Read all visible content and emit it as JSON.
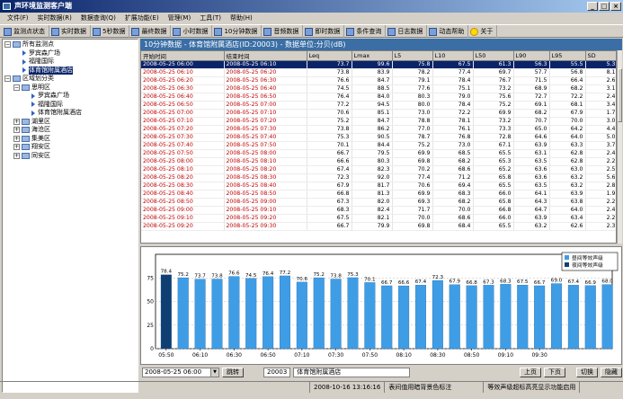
{
  "window": {
    "title": "声环境监测客户端",
    "controls": [
      "_",
      "□",
      "×"
    ]
  },
  "menu": [
    "文件(F)",
    "实时数据(R)",
    "数据查询(Q)",
    "扩展功能(E)",
    "管理(M)",
    "工具(T)",
    "帮助(H)"
  ],
  "toolbar": [
    {
      "label": "监测点状态",
      "icon": "monitor-icon"
    },
    {
      "label": "实时数据",
      "icon": "realtime-icon"
    },
    {
      "label": "5秒数据",
      "icon": "data-icon"
    },
    {
      "label": "最终数据",
      "icon": "data-icon"
    },
    {
      "label": "小时数据",
      "icon": "data-icon"
    },
    {
      "label": "10分钟数据",
      "icon": "data-icon"
    },
    {
      "label": "音频数据",
      "icon": "audio-icon"
    },
    {
      "label": "即时数据",
      "icon": "data-icon"
    },
    {
      "label": "条件查询",
      "icon": "query-icon"
    },
    {
      "label": "日志数据",
      "icon": "log-icon"
    },
    {
      "label": "动态帮助",
      "icon": "help-icon"
    },
    {
      "label": "关于",
      "icon": "bulb-icon"
    }
  ],
  "tree": [
    {
      "label": "所有监测点",
      "type": "root"
    },
    {
      "label": "罗宾森广场",
      "type": "leaf"
    },
    {
      "label": "福隆国际",
      "type": "leaf"
    },
    {
      "label": "体育馆附属酒店",
      "type": "leaf"
    },
    {
      "label": "区域划分类",
      "type": "root"
    },
    {
      "label": "思明区",
      "type": "folder"
    },
    {
      "label": "罗宾森广场",
      "type": "leaf"
    },
    {
      "label": "福隆国际",
      "type": "leaf"
    },
    {
      "label": "体育馆附属酒店",
      "type": "leaf"
    },
    {
      "label": "湖里区",
      "type": "folder"
    },
    {
      "label": "海沧区",
      "type": "folder"
    },
    {
      "label": "集美区",
      "type": "folder"
    },
    {
      "label": "翔安区",
      "type": "folder"
    },
    {
      "label": "同安区",
      "type": "folder"
    }
  ],
  "panel": {
    "header": "10分钟数据 - 体育馆附属酒店(ID:20003) - 数据单位:分贝(dB)"
  },
  "table": {
    "columns": [
      "开始时间",
      "结束时间",
      "Leq",
      "Lmax",
      "L5",
      "L10",
      "L50",
      "L90",
      "L95",
      "SD"
    ],
    "rows": [
      [
        "2008-05-25 06:00",
        "2008-05-25 06:10",
        "73.7",
        "99.6",
        "75.8",
        "67.5",
        "61.3",
        "56.3",
        "55.5",
        "5.3"
      ],
      [
        "2008-05-25 06:10",
        "2008-05-25 06:20",
        "73.8",
        "83.9",
        "78.2",
        "77.4",
        "69.7",
        "57.7",
        "56.8",
        "8.1"
      ],
      [
        "2008-05-25 06:20",
        "2008-05-25 06:30",
        "76.6",
        "84.7",
        "79.1",
        "78.4",
        "76.7",
        "71.5",
        "66.4",
        "2.6"
      ],
      [
        "2008-05-25 06:30",
        "2008-05-25 06:40",
        "74.5",
        "88.5",
        "77.6",
        "75.1",
        "73.2",
        "68.9",
        "68.2",
        "3.1"
      ],
      [
        "2008-05-25 06:40",
        "2008-05-25 06:50",
        "76.4",
        "84.0",
        "80.3",
        "79.0",
        "75.6",
        "72.7",
        "72.2",
        "2.4"
      ],
      [
        "2008-05-25 06:50",
        "2008-05-25 07:00",
        "77.2",
        "94.5",
        "80.0",
        "78.4",
        "75.2",
        "69.1",
        "68.1",
        "3.4"
      ],
      [
        "2008-05-25 07:00",
        "2008-05-25 07:10",
        "70.6",
        "85.1",
        "73.0",
        "72.2",
        "69.9",
        "68.2",
        "67.9",
        "1.7"
      ],
      [
        "2008-05-25 07:10",
        "2008-05-25 07:20",
        "75.2",
        "84.7",
        "78.8",
        "78.1",
        "73.2",
        "70.7",
        "70.0",
        "3.0"
      ],
      [
        "2008-05-25 07:20",
        "2008-05-25 07:30",
        "73.8",
        "86.2",
        "77.0",
        "76.1",
        "73.3",
        "65.0",
        "64.2",
        "4.4"
      ],
      [
        "2008-05-25 07:30",
        "2008-05-25 07:40",
        "75.3",
        "90.5",
        "78.7",
        "76.8",
        "72.8",
        "64.6",
        "64.0",
        "5.0"
      ],
      [
        "2008-05-25 07:40",
        "2008-05-25 07:50",
        "70.1",
        "84.4",
        "75.2",
        "73.0",
        "67.1",
        "63.9",
        "63.3",
        "3.7"
      ],
      [
        "2008-05-25 07:50",
        "2008-05-25 08:00",
        "66.7",
        "79.5",
        "69.9",
        "68.5",
        "65.5",
        "63.1",
        "62.8",
        "2.4"
      ],
      [
        "2008-05-25 08:00",
        "2008-05-25 08:10",
        "66.6",
        "80.3",
        "69.8",
        "68.2",
        "65.3",
        "63.5",
        "62.8",
        "2.2"
      ],
      [
        "2008-05-25 08:10",
        "2008-05-25 08:20",
        "67.4",
        "82.3",
        "70.2",
        "68.6",
        "65.2",
        "63.6",
        "63.0",
        "2.5"
      ],
      [
        "2008-05-25 08:20",
        "2008-05-25 08:30",
        "72.3",
        "92.0",
        "77.4",
        "71.2",
        "65.8",
        "63.6",
        "63.2",
        "5.6"
      ],
      [
        "2008-05-25 08:30",
        "2008-05-25 08:40",
        "67.9",
        "81.7",
        "70.6",
        "69.4",
        "65.5",
        "63.5",
        "63.2",
        "2.8"
      ],
      [
        "2008-05-25 08:40",
        "2008-05-25 08:50",
        "66.8",
        "81.3",
        "69.9",
        "68.3",
        "66.0",
        "64.1",
        "63.9",
        "1.9"
      ],
      [
        "2008-05-25 08:50",
        "2008-05-25 09:00",
        "67.3",
        "82.0",
        "69.3",
        "68.2",
        "65.8",
        "64.3",
        "63.8",
        "2.2"
      ],
      [
        "2008-05-25 09:00",
        "2008-05-25 09:10",
        "68.3",
        "82.4",
        "71.7",
        "70.0",
        "66.8",
        "64.7",
        "64.0",
        "2.4"
      ],
      [
        "2008-05-25 09:10",
        "2008-05-25 09:20",
        "67.5",
        "82.1",
        "70.0",
        "68.6",
        "66.0",
        "63.9",
        "63.4",
        "2.2"
      ],
      [
        "2008-05-25 09:20",
        "2008-05-25 09:30",
        "66.7",
        "79.9",
        "69.8",
        "68.4",
        "65.5",
        "63.2",
        "62.6",
        "2.3"
      ]
    ],
    "selected_row": 0
  },
  "chart_data": {
    "type": "bar",
    "categories": [
      "05:50",
      "06:00",
      "06:10",
      "06:20",
      "06:30",
      "06:40",
      "06:50",
      "07:00",
      "07:10",
      "07:20",
      "07:30",
      "07:40",
      "07:50",
      "08:00",
      "08:10",
      "08:20",
      "08:30",
      "08:40",
      "08:50",
      "09:00",
      "09:10",
      "09:20",
      "09:30",
      "09:40"
    ],
    "values": [
      78.4,
      75.2,
      73.7,
      73.8,
      76.6,
      74.5,
      76.4,
      77.2,
      70.6,
      75.2,
      73.8,
      75.3,
      70.1,
      66.7,
      66.6,
      67.4,
      72.3,
      67.9,
      66.8,
      67.3,
      68.3,
      67.5,
      66.7,
      69.0
    ],
    "extra_values": [
      67.4,
      66.9,
      68.0
    ],
    "xtick_labels": [
      "05:50",
      "06:10",
      "06:30",
      "06:50",
      "07:10",
      "07:30",
      "07:50",
      "08:10",
      "08:30",
      "08:50",
      "09:10",
      "09:30"
    ],
    "ylim": [
      0,
      100
    ],
    "yticks": [
      0,
      25,
      50,
      75
    ],
    "legend": [
      "昼间等效声级",
      "夜间等效声级"
    ],
    "colors": {
      "day": "#3f9de6",
      "night": "#0f3f72"
    },
    "night_indices": [
      0
    ]
  },
  "bottom": {
    "date_value": "2008-05-25 06:00",
    "jump_label": "跳转",
    "station_id": "20003",
    "station_name": "体育馆附属酒店",
    "prev_label": "上页",
    "next_label": "下页",
    "switch_label": "切换",
    "hide_label": "隐藏"
  },
  "status": {
    "datetime": "2008-10-16 13:16:16",
    "msg1": "表间值用暗背景色标注",
    "msg2": "等效声级超标高亮显示功能启用"
  }
}
